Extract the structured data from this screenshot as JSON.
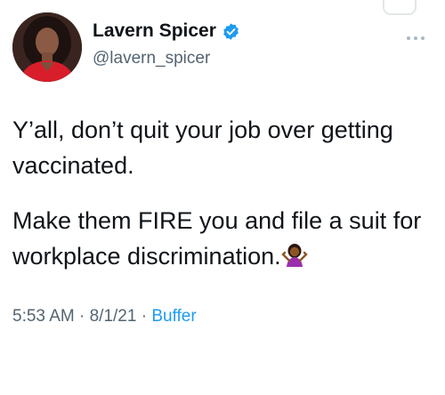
{
  "author": {
    "display_name": "Lavern Spicer",
    "handle": "@lavern_spicer",
    "verified": true,
    "avatar_icon": "profile-photo"
  },
  "tweet": {
    "paragraph1": "Y’all, don’t quit your job over getting vaccinated.",
    "paragraph2": "Make them FIRE you and file a suit for workplace discrimination.",
    "emoji": "person-shrugging-emoji"
  },
  "meta": {
    "time": "5:53 AM",
    "separator": "·",
    "date": "8/1/21",
    "source": "Buffer"
  },
  "colors": {
    "text": "#0f1419",
    "secondary": "#536471",
    "accent": "#1d9bf0"
  },
  "icons": [
    "verified-badge-icon",
    "more-icon"
  ]
}
